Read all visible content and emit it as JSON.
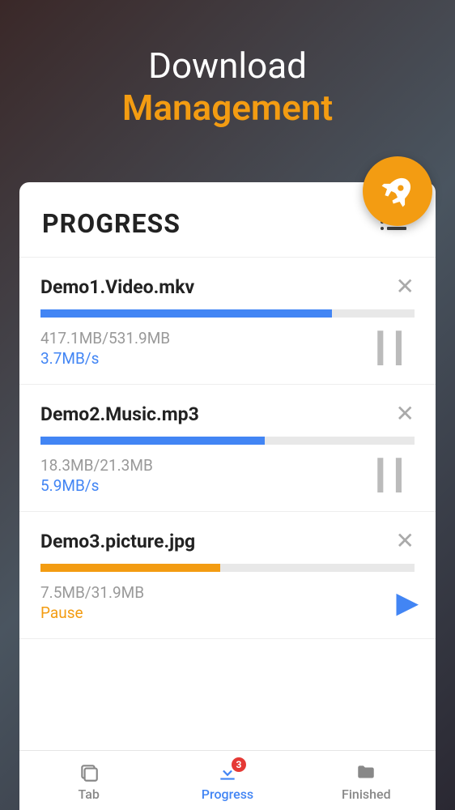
{
  "header": {
    "line1": "Download",
    "line2": "Management"
  },
  "card": {
    "title": "PROGRESS"
  },
  "downloads": [
    {
      "filename": "Demo1.Video.mkv",
      "size_text": "417.1MB/531.9MB",
      "speed": "3.7MB/s",
      "progress_pct": 78,
      "state": "downloading",
      "color": "#4285f4"
    },
    {
      "filename": "Demo2.Music.mp3",
      "size_text": "18.3MB/21.3MB",
      "speed": "5.9MB/s",
      "progress_pct": 60,
      "state": "downloading",
      "color": "#4285f4"
    },
    {
      "filename": "Demo3.picture.jpg",
      "size_text": "7.5MB/31.9MB",
      "status_label": "Pause",
      "progress_pct": 48,
      "state": "paused",
      "color": "#f39c12"
    }
  ],
  "nav": {
    "tab": "Tab",
    "progress": "Progress",
    "progress_badge": "3",
    "finished": "Finished"
  }
}
